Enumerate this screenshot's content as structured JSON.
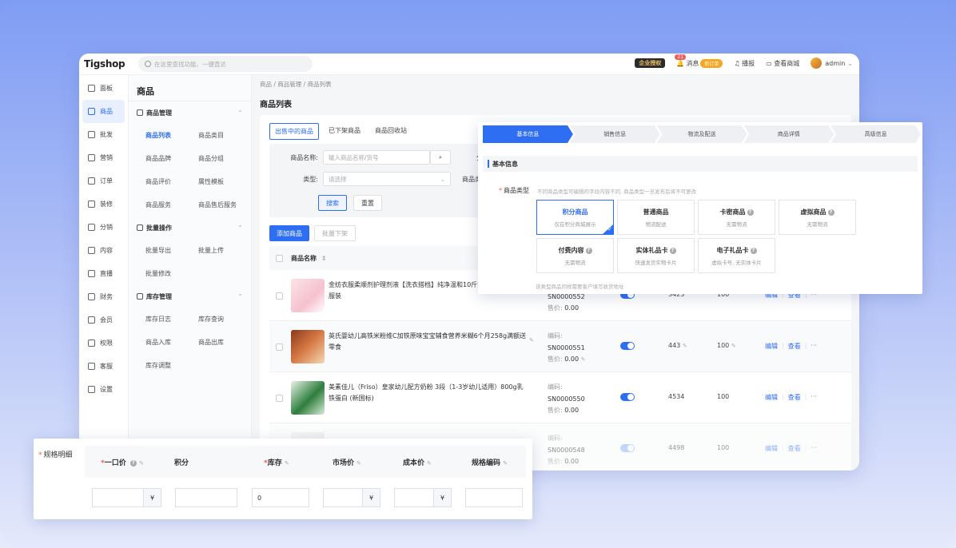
{
  "app": {
    "logo": "Tigshop",
    "search_placeholder": "在这里查找功能、一键直达",
    "enterprise_badge": "企业授权",
    "msg_count": "21",
    "msg_label": "消息",
    "new_msg_badge": "新订单",
    "live_label": "播报",
    "view_store_label": "查看商城",
    "user": "admin"
  },
  "sidebar": {
    "items": [
      {
        "label": "面板",
        "icon": "dashboard-icon"
      },
      {
        "label": "商品",
        "icon": "cube-icon"
      },
      {
        "label": "批发",
        "icon": "store-icon"
      },
      {
        "label": "营销",
        "icon": "gift-icon"
      },
      {
        "label": "订单",
        "icon": "order-icon"
      },
      {
        "label": "装修",
        "icon": "brush-icon"
      },
      {
        "label": "分销",
        "icon": "share-icon"
      },
      {
        "label": "内容",
        "icon": "document-icon"
      },
      {
        "label": "直播",
        "icon": "tv-icon"
      },
      {
        "label": "财务",
        "icon": "finance-icon"
      },
      {
        "label": "会员",
        "icon": "crown-icon"
      },
      {
        "label": "权限",
        "icon": "shield-icon"
      },
      {
        "label": "客服",
        "icon": "headset-icon"
      },
      {
        "label": "设置",
        "icon": "settings-icon"
      }
    ]
  },
  "submenu": {
    "title": "商品",
    "groups": [
      {
        "title": "商品管理",
        "links": [
          "商品列表",
          "商品类目",
          "商品品牌",
          "商品分组",
          "商品评价",
          "属性模板",
          "商品服务",
          "商品售后服务"
        ]
      },
      {
        "title": "批量操作",
        "links": [
          "批量导出",
          "批量上传",
          "批量修改"
        ]
      },
      {
        "title": "库存管理",
        "links": [
          "库存日志",
          "库存查询",
          "商品入库",
          "商品出库",
          "库存调整"
        ]
      }
    ]
  },
  "main": {
    "breadcrumb": "商品 / 商品管理 / 商品列表",
    "title": "商品列表",
    "tabs": [
      "出售中的商品",
      "已下架商品",
      "商品回收站"
    ],
    "filter": {
      "name_label": "商品名称:",
      "name_placeholder": "输入商品名称/货号",
      "type_label": "类型:",
      "type_placeholder": "请选择",
      "cat_label_cut": "商品类",
      "fen_cut": "分",
      "search_btn": "搜索",
      "reset_btn": "重置"
    },
    "add_btn": "添加商品",
    "batch_off_btn": "批量下架",
    "col_name": "商品名称",
    "rows": [
      {
        "name": "金纺衣服柔顺剂护理剂液【洗衣搭档】纯净温和10斤家庭奶香味装重服装",
        "code_label": "编码:",
        "code": "SN0000552",
        "price_label": "售价:",
        "price": "0.00",
        "stock": "3423",
        "sales": "100",
        "edit": "编辑",
        "view": "查看",
        "more": "···"
      },
      {
        "name": "英氏婴幼儿高铁米粉维C加铁原味宝宝辅食营养米糊6个月258g满额送零食",
        "code_label": "编码:",
        "code": "SN0000551",
        "price_label": "售价:",
        "price": "0.00",
        "stock": "443",
        "sales": "100",
        "edit": "编辑",
        "view": "查看",
        "more": "···"
      },
      {
        "name": "美素佳儿（Friso）皇家幼儿配方奶粉 3段（1-3岁幼儿适用）800g乳铁蛋白 (新国标)",
        "code_label": "编码:",
        "code": "SN0000550",
        "price_label": "售价:",
        "price": "0.00",
        "stock": "4534",
        "sales": "100",
        "edit": "编辑",
        "view": "查看",
        "more": "···"
      },
      {
        "name": "",
        "code_label": "编码:",
        "code": "SN0000548",
        "price_label": "售价:",
        "price": "0.00",
        "stock": "4498",
        "sales": "100",
        "edit": "编辑",
        "view": "查看",
        "more": "···"
      }
    ]
  },
  "panel": {
    "steps": [
      "基本信息",
      "销售信息",
      "物流及配送",
      "商品详情",
      "高级信息"
    ],
    "section": "基本信息",
    "ptype_label": "商品类型",
    "ptype_hint": "不同商品类型可编辑的字段内容不同, 商品类型一旦发布后将不可更改",
    "types": [
      {
        "t": "积分商品",
        "s": "仅在积分商城展示",
        "q": false
      },
      {
        "t": "普通商品",
        "s": "物流配送",
        "q": false
      },
      {
        "t": "卡密商品",
        "s": "无需物流",
        "q": true
      },
      {
        "t": "虚拟商品",
        "s": "无需物流",
        "q": true
      },
      {
        "t": "付费内容",
        "s": "无需物流",
        "q": true
      },
      {
        "t": "实体礼品卡",
        "s": "快速发货实物卡片",
        "q": true
      },
      {
        "t": "电子礼品卡",
        "s": "虚拟卡号, 无实体卡片",
        "q": true
      }
    ],
    "foot": "该类型商品同样需要客户填写收货地址"
  },
  "spec": {
    "label": "规格明细",
    "cols": [
      "一口价",
      "积分",
      "库存",
      "市场价",
      "成本价",
      "规格编码"
    ],
    "stock_value": "0",
    "yen": "¥"
  },
  "colors": {
    "primary": "#2e6ef2",
    "danger": "#f25b5b"
  }
}
